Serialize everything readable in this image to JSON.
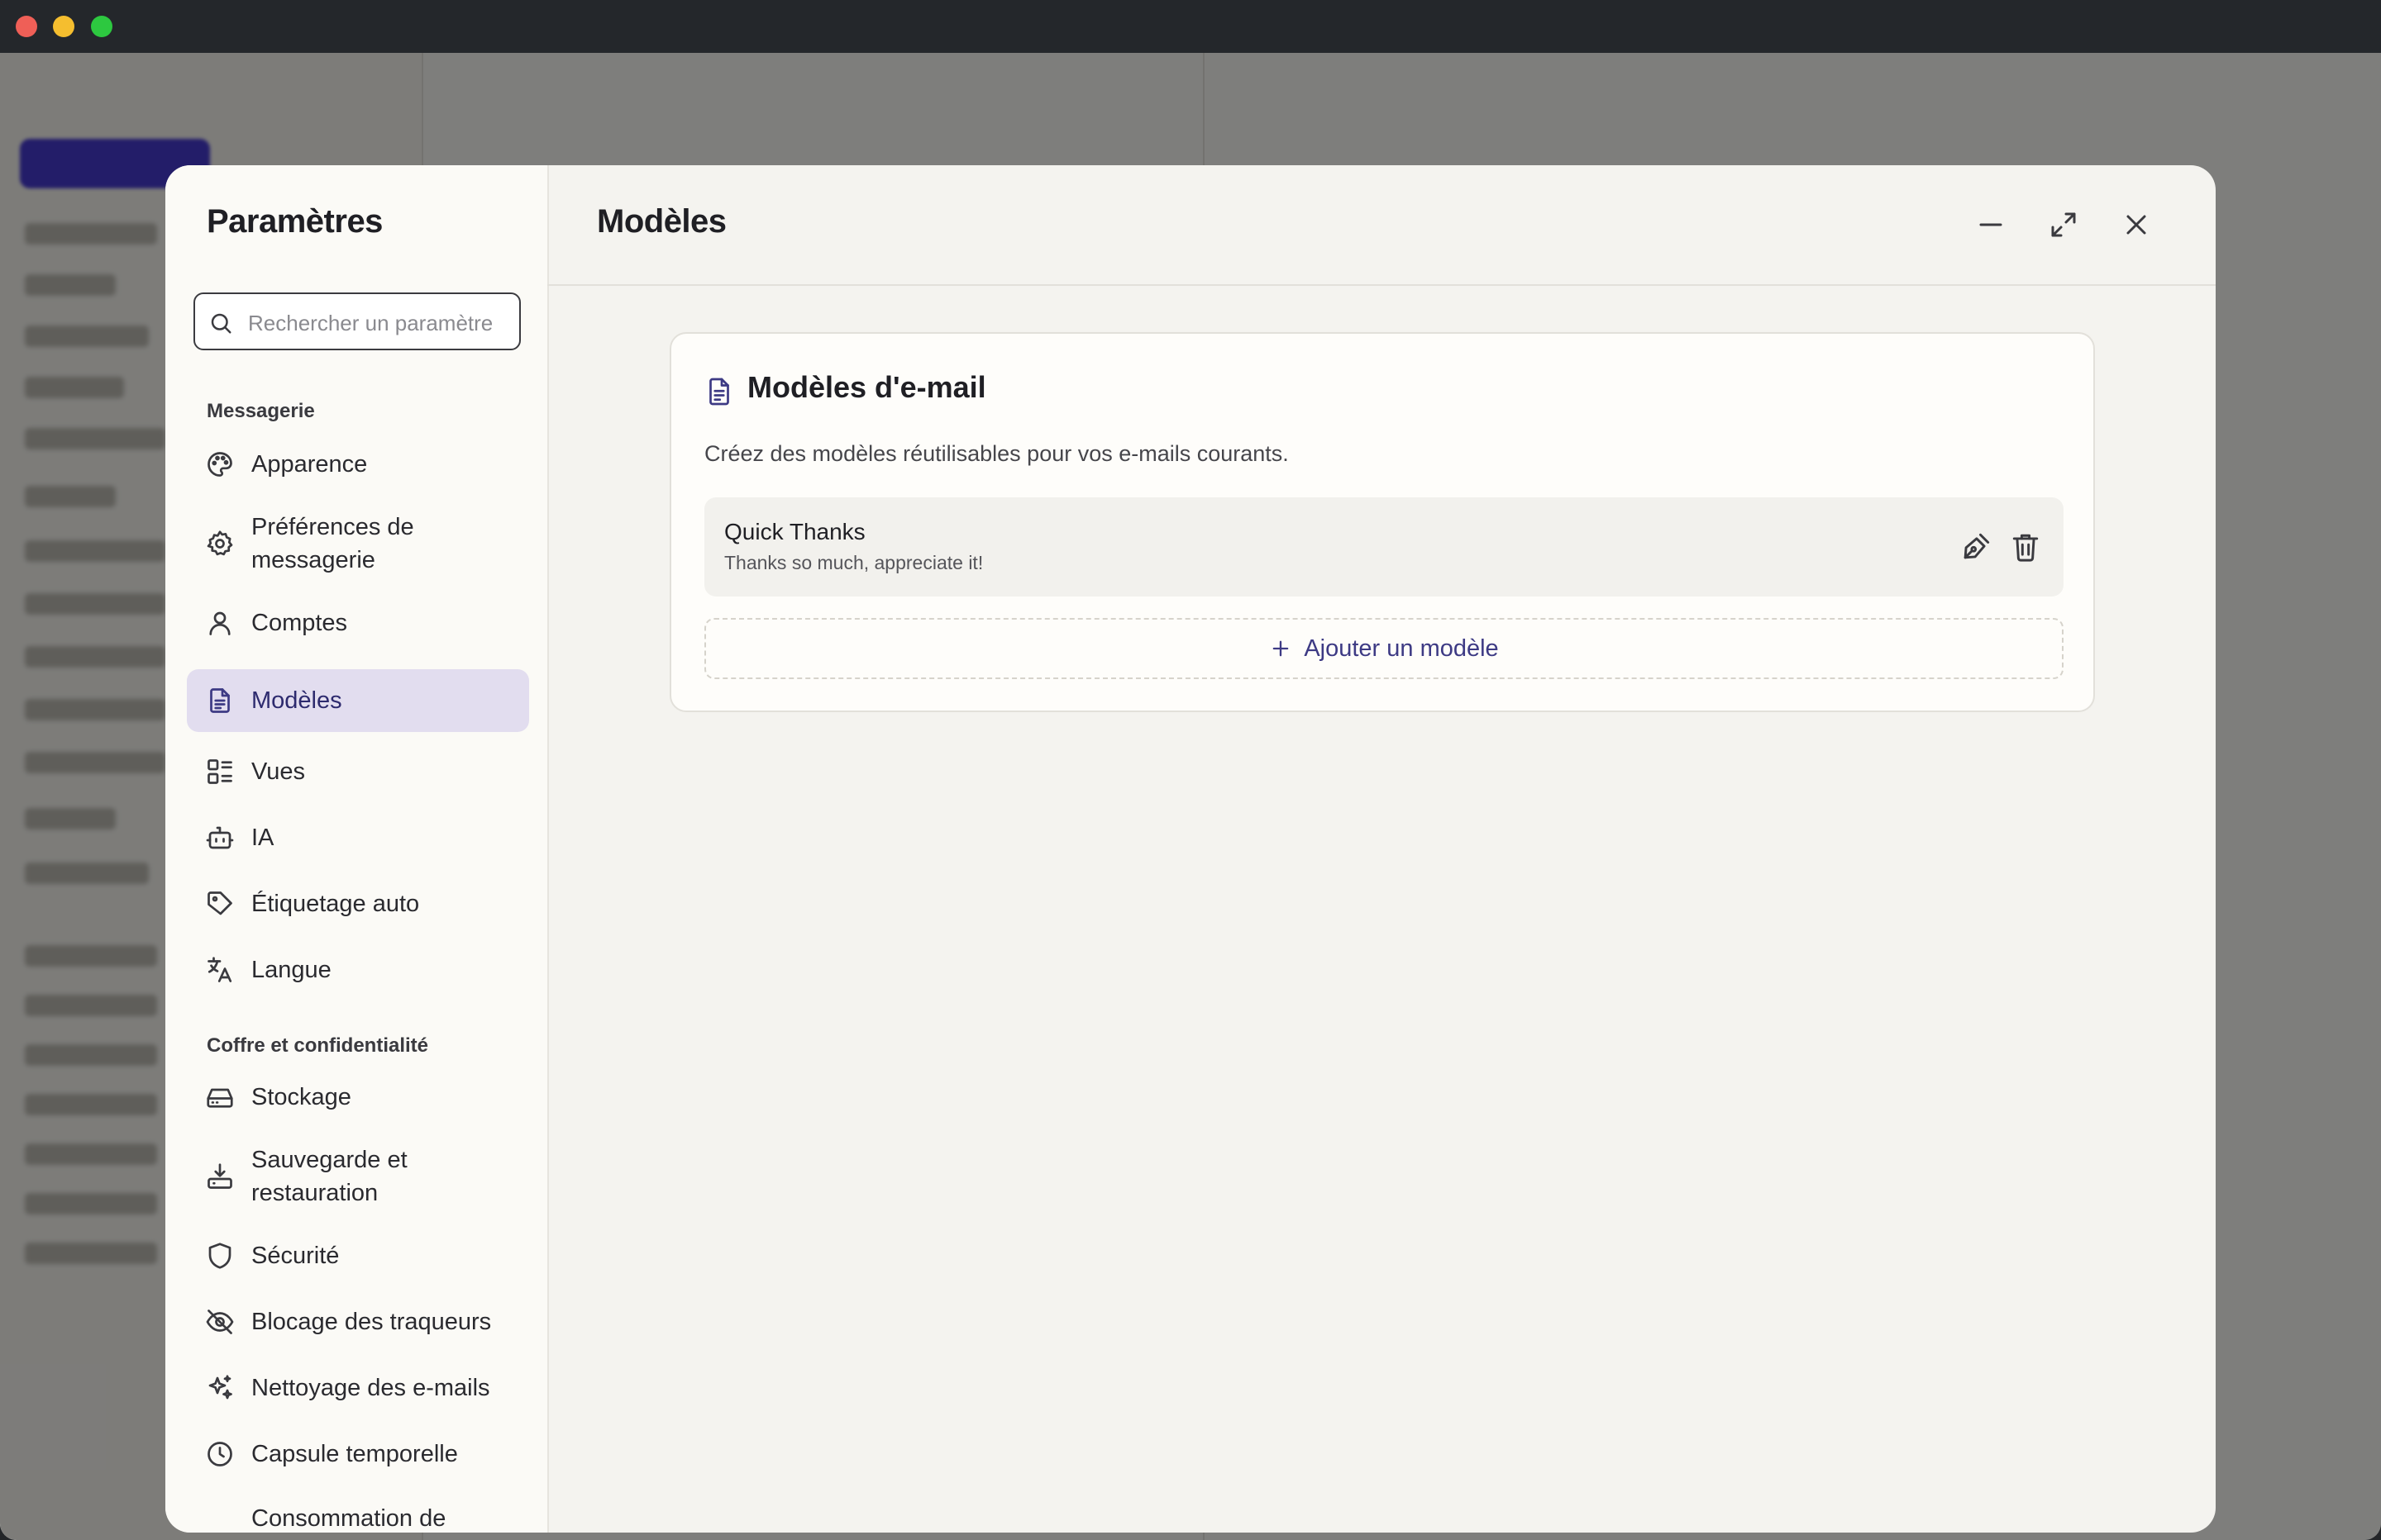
{
  "colors": {
    "accent": "#3d3a84",
    "active_bg": "#e2ddef",
    "traffic_red": "#ef5f57",
    "traffic_yellow": "#f5be2f",
    "traffic_green": "#2dc840"
  },
  "settings": {
    "title": "Paramètres",
    "search_placeholder": "Rechercher un paramètre",
    "sections": [
      {
        "label": "Messagerie",
        "items": [
          {
            "label": "Apparence",
            "icon": "palette-icon"
          },
          {
            "label": "Préférences de messagerie",
            "icon": "gear-icon"
          },
          {
            "label": "Comptes",
            "icon": "user-icon"
          },
          {
            "label": "Modèles",
            "icon": "document-icon",
            "active": true
          },
          {
            "label": "Vues",
            "icon": "layout-list-icon"
          },
          {
            "label": "IA",
            "icon": "bot-icon"
          },
          {
            "label": "Étiquetage auto",
            "icon": "tag-icon"
          },
          {
            "label": "Langue",
            "icon": "translate-icon"
          }
        ]
      },
      {
        "label": "Coffre et confidentialité",
        "items": [
          {
            "label": "Stockage",
            "icon": "hard-drive-icon"
          },
          {
            "label": "Sauvegarde et restauration",
            "icon": "download-icon"
          },
          {
            "label": "Sécurité",
            "icon": "shield-icon"
          },
          {
            "label": "Blocage des traqueurs",
            "icon": "eye-off-icon"
          },
          {
            "label": "Nettoyage des e-mails",
            "icon": "sparkles-icon"
          },
          {
            "label": "Capsule temporelle",
            "icon": "clock-icon"
          },
          {
            "label": "Consommation de",
            "icon": "none"
          }
        ]
      }
    ]
  },
  "content": {
    "title": "Modèles",
    "header_buttons": [
      "minimize-icon",
      "expand-icon",
      "close-icon"
    ],
    "card": {
      "title": "Modèles d'e-mail",
      "description": "Créez des modèles réutilisables pour vos e-mails courants.",
      "templates": [
        {
          "name": "Quick Thanks",
          "preview": "Thanks so much, appreciate it!"
        }
      ],
      "add_label": "Ajouter un modèle"
    }
  }
}
